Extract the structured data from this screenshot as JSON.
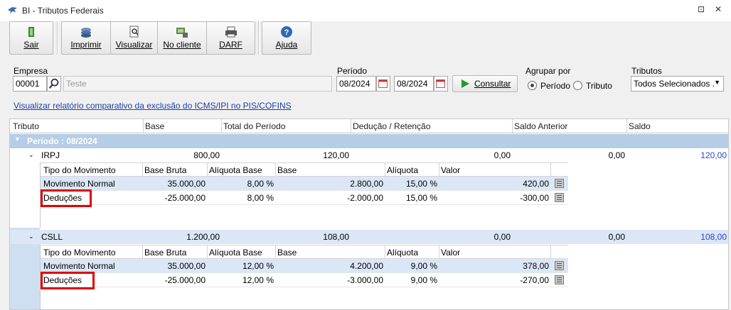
{
  "window": {
    "title": "BI - Tributos Federais",
    "restore_glyph": "⊡",
    "close_glyph": "✕"
  },
  "toolbar": {
    "sair": "Sair",
    "imprimir": "Imprimir",
    "visualizar": "Visualizar",
    "no_cliente": "No cliente",
    "darf": "DARF",
    "ajuda": "Ajuda"
  },
  "form": {
    "empresa_label": "Empresa",
    "empresa_code": "00001",
    "empresa_name": "Teste",
    "periodo_label": "Período",
    "periodo_from": "08/2024",
    "periodo_to": "08/2024",
    "consultar": "Consultar",
    "agrupar_label": "Agrupar por",
    "agrupar_periodo": "Período",
    "agrupar_tributo": "Tributo",
    "tributos_label": "Tributos",
    "tributos_value": "Todos Selecionados ."
  },
  "link": "Visualizar relatório comparativo da exclusão do ICMS/IPI no PIS/COFINS",
  "grid": {
    "headers": [
      "Tributo",
      "Base",
      "Total do Período",
      "Dedução / Retenção",
      "Saldo Anterior",
      "Saldo"
    ],
    "group": "Período : 08/2024",
    "sub_headers": [
      "Tipo do Movimento",
      "Base Bruta",
      "Alíquota Base",
      "Base",
      "Alíquota",
      "Valor"
    ],
    "tributos": [
      {
        "name": "IRPJ",
        "base": "800,00",
        "total": "120,00",
        "deducao": "0,00",
        "saldo_anterior": "0,00",
        "saldo": "120,00",
        "rows": [
          {
            "tipo": "Movimento Normal",
            "base_bruta": "35.000,00",
            "aliquota_base": "8,00 %",
            "base": "2.800,00",
            "aliquota": "15,00 %",
            "valor": "420,00"
          },
          {
            "tipo": "Deduções",
            "base_bruta": "-25.000,00",
            "aliquota_base": "8,00 %",
            "base": "-2.000,00",
            "aliquota": "15,00 %",
            "valor": "-300,00"
          }
        ]
      },
      {
        "name": "CSLL",
        "base": "1.200,00",
        "total": "108,00",
        "deducao": "0,00",
        "saldo_anterior": "0,00",
        "saldo": "108,00",
        "rows": [
          {
            "tipo": "Movimento Normal",
            "base_bruta": "35.000,00",
            "aliquota_base": "12,00 %",
            "base": "4.200,00",
            "aliquota": "9,00 %",
            "valor": "378,00"
          },
          {
            "tipo": "Deduções",
            "base_bruta": "-25.000,00",
            "aliquota_base": "12,00 %",
            "base": "-3.000,00",
            "aliquota": "9,00 %",
            "valor": "-270,00"
          }
        ]
      }
    ]
  },
  "colors": {
    "accent_link": "#1c3ea8",
    "group_header": "#b6cde6",
    "highlight_box": "#e00000",
    "saldo_blue": "#2b45c9"
  }
}
